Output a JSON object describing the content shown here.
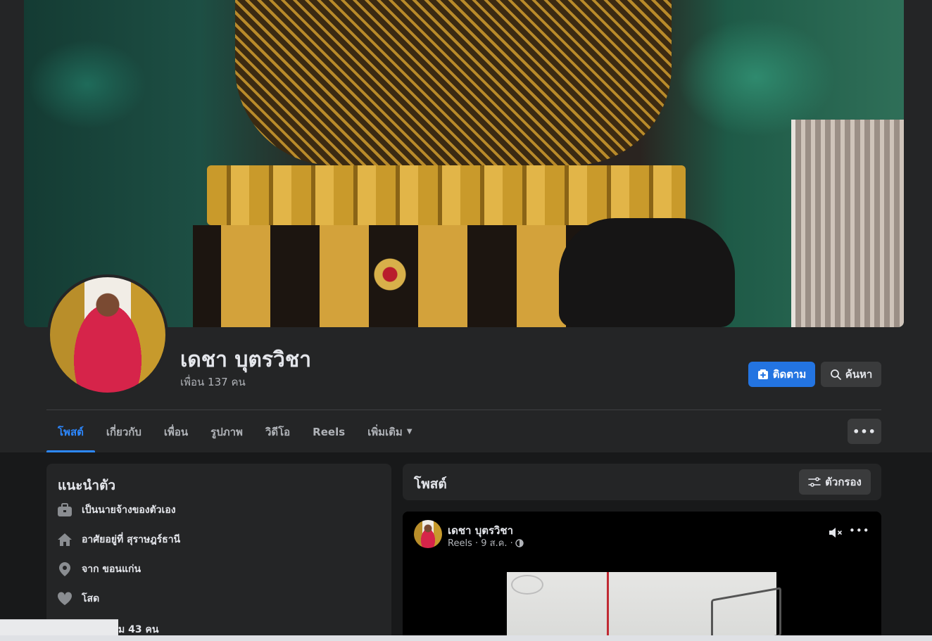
{
  "profile": {
    "name": "เดชา บุตรวิชา",
    "friends_text": "เพื่อน 137 คน"
  },
  "actions": {
    "follow_label": "ติดตาม",
    "search_label": "ค้นหา"
  },
  "tabs": [
    {
      "label": "โพสต์",
      "active": true
    },
    {
      "label": "เกี่ยวกับ",
      "active": false
    },
    {
      "label": "เพื่อน",
      "active": false
    },
    {
      "label": "รูปภาพ",
      "active": false
    },
    {
      "label": "วิดีโอ",
      "active": false
    },
    {
      "label": "Reels",
      "active": false
    },
    {
      "label": "เพิ่มเติม",
      "active": false
    }
  ],
  "intro": {
    "title": "แนะนำตัว",
    "items": [
      {
        "icon": "briefcase-icon",
        "text": "เป็นนายจ้างของตัวเอง"
      },
      {
        "icon": "home-icon",
        "text": "อาศัยอยู่ที่ สุราษฎร์ธานี"
      },
      {
        "icon": "location-pin-icon",
        "text": "จาก ขอนแก่น"
      },
      {
        "icon": "heart-icon",
        "text": "โสด"
      }
    ],
    "partial_text": "ม 43 คน"
  },
  "posts": {
    "title": "โพสต์",
    "filter_label": "ตัวกรอง"
  },
  "post": {
    "author": "เดชา บุตรวิชา",
    "meta": "Reels · 9 ส.ค. ·"
  },
  "colors": {
    "accent": "#2374e1",
    "active_tab": "#2d88ff",
    "surface": "#242526",
    "background": "#18191a"
  }
}
